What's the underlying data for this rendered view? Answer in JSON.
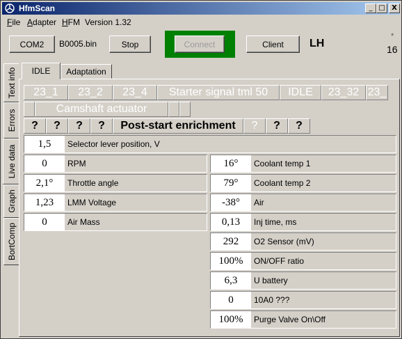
{
  "window": {
    "title": "HfmScan"
  },
  "title_buttons": {
    "minimize": "_",
    "maximize": "□",
    "close": "X"
  },
  "menu": [
    {
      "label": "File",
      "hot": "F",
      "rest": "ile"
    },
    {
      "label": "Adapter",
      "hot": "A",
      "rest": "dapter"
    },
    {
      "label": "HFM",
      "hot": "H",
      "rest": "FM"
    },
    {
      "label": "Version 1.32",
      "hot": "",
      "rest": "Version 1.32"
    }
  ],
  "toolbar": {
    "com_port": "COM2",
    "file_name": "B0005.bin",
    "stop_label": "Stop",
    "connect_label": "Connect",
    "client_label": "Client",
    "mode_label": "LH",
    "counter_mark": "*",
    "counter": "16"
  },
  "side_tabs": [
    "Text info",
    "Errors",
    "Live data",
    "Graph",
    "BortComp"
  ],
  "top_tabs": [
    "IDLE",
    "Adaptation"
  ],
  "signals_row1": [
    "23_1",
    "23_2",
    "23_4",
    "Starter signal tml 50",
    "IDLE",
    "23_32",
    "23_"
  ],
  "signals_row2": [
    "",
    "Camshaft actuator",
    "",
    ""
  ],
  "signals_row3": [
    "?",
    "?",
    "?",
    "?",
    "Post-start enrichment",
    "?",
    "?",
    "?"
  ],
  "selector": {
    "value": "1,5",
    "label": "Selector lever position, V"
  },
  "left_values": [
    {
      "value": "0",
      "label": "RPM"
    },
    {
      "value": "2,1°",
      "label": "Throttle angle"
    },
    {
      "value": "1,23",
      "label": "LMM Voltage"
    },
    {
      "value": "0",
      "label": "Air Mass"
    }
  ],
  "right_values": [
    {
      "value": "16°",
      "label": "Coolant temp 1"
    },
    {
      "value": "79°",
      "label": "Coolant temp 2"
    },
    {
      "value": "-38°",
      "label": "Air"
    },
    {
      "value": "0,13",
      "label": "Inj time, ms"
    },
    {
      "value": "292",
      "label": "O2 Sensor (mV)"
    },
    {
      "value": "100%",
      "label": "ON/OFF ratio"
    },
    {
      "value": "6,3",
      "label": "U battery"
    },
    {
      "value": "0",
      "label": "10A0  ???"
    },
    {
      "value": "100%",
      "label": "Purge Valve On\\Off"
    }
  ]
}
